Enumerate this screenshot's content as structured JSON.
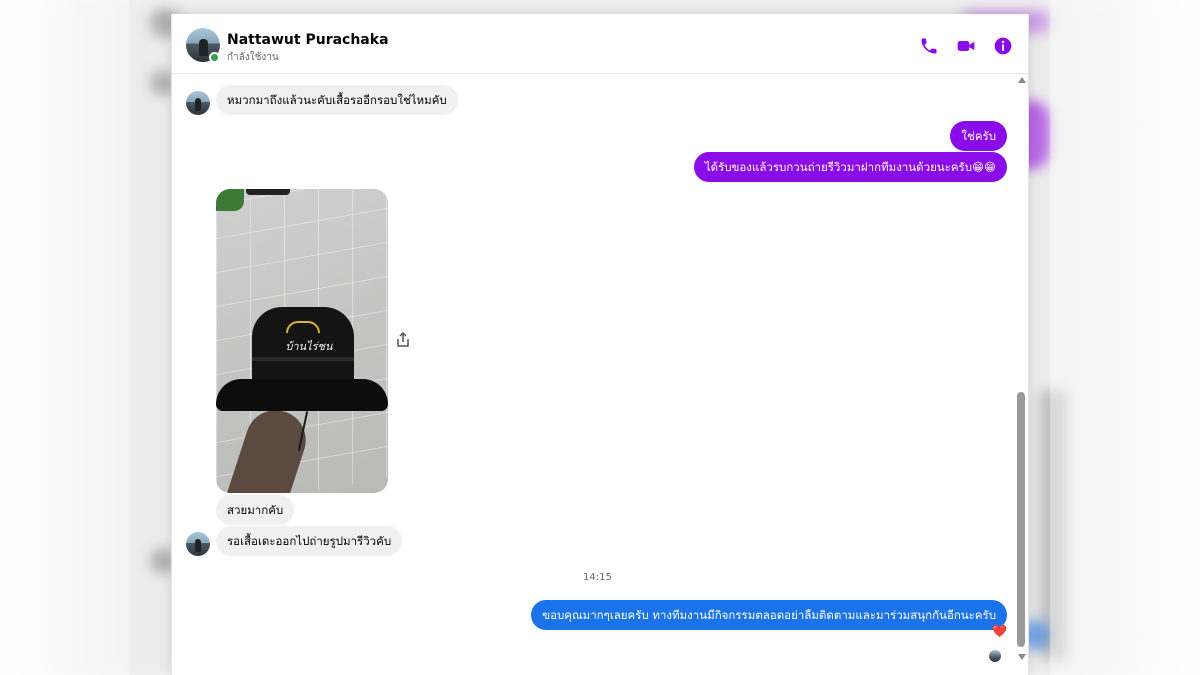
{
  "header": {
    "name": "Nattawut Purachaka",
    "status": "กำลังใช้งาน",
    "icons": [
      "phone-icon",
      "video-call-icon",
      "info-icon"
    ]
  },
  "messages": {
    "m1": "หมวกมาถึงแล้วนะคับเสื้อรออีกรอบใช่ไหมคับ",
    "m2": "ใช่ครับ",
    "m3": "ได้รับของแล้วรบกวนถ่ายรีวิวมาฝากทีมงานด้วยนะครับ😁😁",
    "photo_caption": "บ้านไร่ชน",
    "m4": "สวยมากคับ",
    "m5": "รอเสื้อเดะออกไปถ่ายรูปมารีวิวคับ",
    "timestamp": "14:15",
    "m6": "ขอบคุณมากๆเลยครับ ทางทีมงานมีกิจกรรมตลอดอย่าลืมติดตามและมาร่วมสนุกกันอีกนะครับ",
    "reaction": "❤️"
  },
  "colors": {
    "accent": "#8a0ce8",
    "outgoing_blue": "#1a73e8",
    "incoming_bg": "#f0f0f0",
    "online": "#31a24c"
  }
}
